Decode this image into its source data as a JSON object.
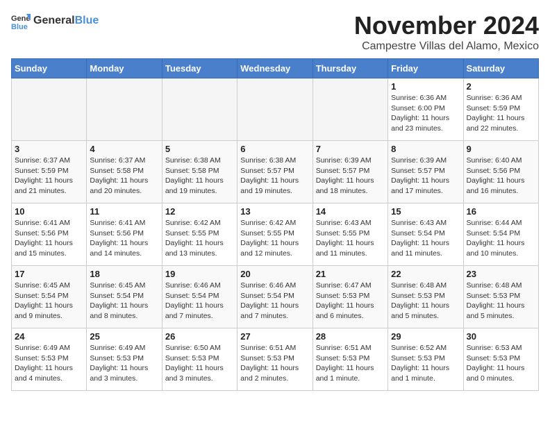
{
  "header": {
    "logo_general": "General",
    "logo_blue": "Blue",
    "month": "November 2024",
    "location": "Campestre Villas del Alamo, Mexico"
  },
  "weekdays": [
    "Sunday",
    "Monday",
    "Tuesday",
    "Wednesday",
    "Thursday",
    "Friday",
    "Saturday"
  ],
  "weeks": [
    [
      {
        "day": "",
        "info": ""
      },
      {
        "day": "",
        "info": ""
      },
      {
        "day": "",
        "info": ""
      },
      {
        "day": "",
        "info": ""
      },
      {
        "day": "",
        "info": ""
      },
      {
        "day": "1",
        "info": "Sunrise: 6:36 AM\nSunset: 6:00 PM\nDaylight: 11 hours and 23 minutes."
      },
      {
        "day": "2",
        "info": "Sunrise: 6:36 AM\nSunset: 5:59 PM\nDaylight: 11 hours and 22 minutes."
      }
    ],
    [
      {
        "day": "3",
        "info": "Sunrise: 6:37 AM\nSunset: 5:59 PM\nDaylight: 11 hours and 21 minutes."
      },
      {
        "day": "4",
        "info": "Sunrise: 6:37 AM\nSunset: 5:58 PM\nDaylight: 11 hours and 20 minutes."
      },
      {
        "day": "5",
        "info": "Sunrise: 6:38 AM\nSunset: 5:58 PM\nDaylight: 11 hours and 19 minutes."
      },
      {
        "day": "6",
        "info": "Sunrise: 6:38 AM\nSunset: 5:57 PM\nDaylight: 11 hours and 19 minutes."
      },
      {
        "day": "7",
        "info": "Sunrise: 6:39 AM\nSunset: 5:57 PM\nDaylight: 11 hours and 18 minutes."
      },
      {
        "day": "8",
        "info": "Sunrise: 6:39 AM\nSunset: 5:57 PM\nDaylight: 11 hours and 17 minutes."
      },
      {
        "day": "9",
        "info": "Sunrise: 6:40 AM\nSunset: 5:56 PM\nDaylight: 11 hours and 16 minutes."
      }
    ],
    [
      {
        "day": "10",
        "info": "Sunrise: 6:41 AM\nSunset: 5:56 PM\nDaylight: 11 hours and 15 minutes."
      },
      {
        "day": "11",
        "info": "Sunrise: 6:41 AM\nSunset: 5:56 PM\nDaylight: 11 hours and 14 minutes."
      },
      {
        "day": "12",
        "info": "Sunrise: 6:42 AM\nSunset: 5:55 PM\nDaylight: 11 hours and 13 minutes."
      },
      {
        "day": "13",
        "info": "Sunrise: 6:42 AM\nSunset: 5:55 PM\nDaylight: 11 hours and 12 minutes."
      },
      {
        "day": "14",
        "info": "Sunrise: 6:43 AM\nSunset: 5:55 PM\nDaylight: 11 hours and 11 minutes."
      },
      {
        "day": "15",
        "info": "Sunrise: 6:43 AM\nSunset: 5:54 PM\nDaylight: 11 hours and 11 minutes."
      },
      {
        "day": "16",
        "info": "Sunrise: 6:44 AM\nSunset: 5:54 PM\nDaylight: 11 hours and 10 minutes."
      }
    ],
    [
      {
        "day": "17",
        "info": "Sunrise: 6:45 AM\nSunset: 5:54 PM\nDaylight: 11 hours and 9 minutes."
      },
      {
        "day": "18",
        "info": "Sunrise: 6:45 AM\nSunset: 5:54 PM\nDaylight: 11 hours and 8 minutes."
      },
      {
        "day": "19",
        "info": "Sunrise: 6:46 AM\nSunset: 5:54 PM\nDaylight: 11 hours and 7 minutes."
      },
      {
        "day": "20",
        "info": "Sunrise: 6:46 AM\nSunset: 5:54 PM\nDaylight: 11 hours and 7 minutes."
      },
      {
        "day": "21",
        "info": "Sunrise: 6:47 AM\nSunset: 5:53 PM\nDaylight: 11 hours and 6 minutes."
      },
      {
        "day": "22",
        "info": "Sunrise: 6:48 AM\nSunset: 5:53 PM\nDaylight: 11 hours and 5 minutes."
      },
      {
        "day": "23",
        "info": "Sunrise: 6:48 AM\nSunset: 5:53 PM\nDaylight: 11 hours and 5 minutes."
      }
    ],
    [
      {
        "day": "24",
        "info": "Sunrise: 6:49 AM\nSunset: 5:53 PM\nDaylight: 11 hours and 4 minutes."
      },
      {
        "day": "25",
        "info": "Sunrise: 6:49 AM\nSunset: 5:53 PM\nDaylight: 11 hours and 3 minutes."
      },
      {
        "day": "26",
        "info": "Sunrise: 6:50 AM\nSunset: 5:53 PM\nDaylight: 11 hours and 3 minutes."
      },
      {
        "day": "27",
        "info": "Sunrise: 6:51 AM\nSunset: 5:53 PM\nDaylight: 11 hours and 2 minutes."
      },
      {
        "day": "28",
        "info": "Sunrise: 6:51 AM\nSunset: 5:53 PM\nDaylight: 11 hours and 1 minute."
      },
      {
        "day": "29",
        "info": "Sunrise: 6:52 AM\nSunset: 5:53 PM\nDaylight: 11 hours and 1 minute."
      },
      {
        "day": "30",
        "info": "Sunrise: 6:53 AM\nSunset: 5:53 PM\nDaylight: 11 hours and 0 minutes."
      }
    ]
  ]
}
